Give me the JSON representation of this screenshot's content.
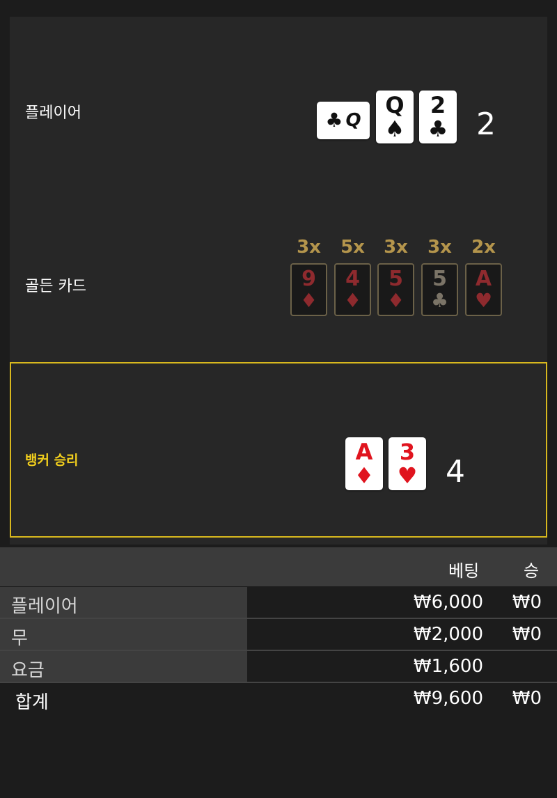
{
  "rows": {
    "player": {
      "label": "플레이어",
      "score": "2"
    },
    "golden": {
      "label": "골든 카드"
    },
    "banker": {
      "label": "뱅커 승리",
      "score": "4"
    }
  },
  "player_cards": [
    {
      "rank": "Q",
      "suit": "♣",
      "color": "black"
    },
    {
      "rank": "Q",
      "suit": "♠",
      "color": "black"
    },
    {
      "rank": "2",
      "suit": "♣",
      "color": "black"
    }
  ],
  "golden_cards": [
    {
      "multiplier": "3x",
      "rank": "9",
      "suit": "♦"
    },
    {
      "multiplier": "5x",
      "rank": "4",
      "suit": "♦"
    },
    {
      "multiplier": "3x",
      "rank": "5",
      "suit": "♦"
    },
    {
      "multiplier": "3x",
      "rank": "5",
      "suit": "♣"
    },
    {
      "multiplier": "2x",
      "rank": "A",
      "suit": "♥"
    }
  ],
  "banker_cards": [
    {
      "rank": "A",
      "suit": "♦",
      "color": "red"
    },
    {
      "rank": "3",
      "suit": "♥",
      "color": "red"
    }
  ],
  "bet_table": {
    "headers": {
      "bet": "베팅",
      "win": "승"
    },
    "rows": [
      {
        "label": "플레이어",
        "bet": "₩6,000",
        "win": "₩0"
      },
      {
        "label": "무",
        "bet": "₩2,000",
        "win": "₩0"
      },
      {
        "label": "요금",
        "bet": "₩1,600",
        "win": ""
      }
    ],
    "total": {
      "label": "합계",
      "bet": "₩9,600",
      "win": "₩0"
    }
  },
  "colors": {
    "background": "#1c1c1c",
    "panel": "#272727",
    "winner_border": "#d8b81e",
    "winner_label": "#f2cf1d",
    "golden_multiplier": "#b4954c",
    "card_red": "#e0141e",
    "golden_red": "#8e2a2e"
  }
}
